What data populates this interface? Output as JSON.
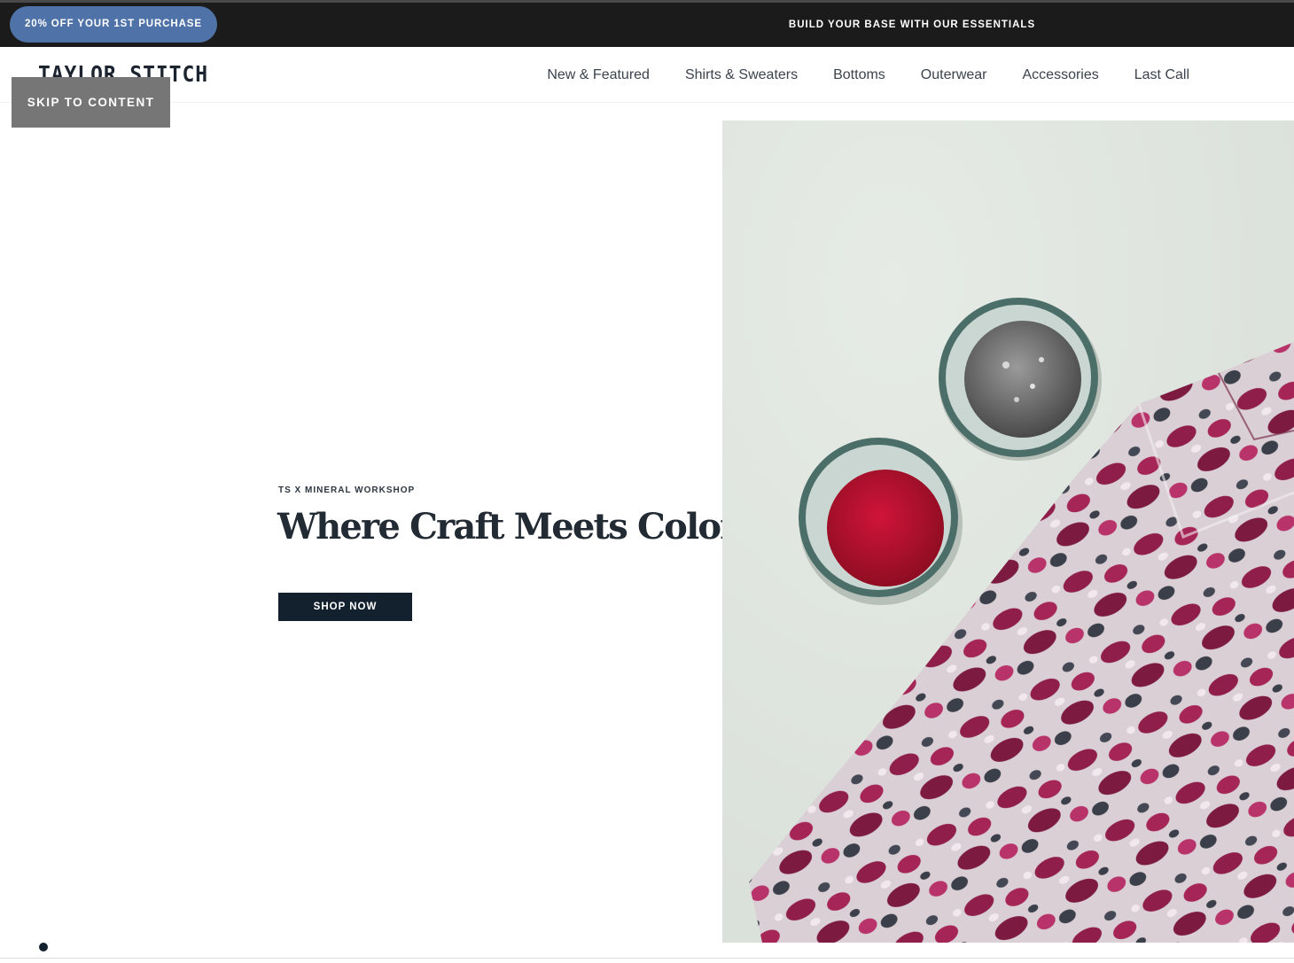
{
  "promo_bar": {
    "pill_label": "20% OFF YOUR 1ST PURCHASE",
    "message": "BUILD YOUR BASE WITH OUR ESSENTIALS"
  },
  "header": {
    "logo": "TAYLOR STITCH",
    "nav": [
      {
        "label": "New & Featured"
      },
      {
        "label": "Shirts & Sweaters"
      },
      {
        "label": "Bottoms"
      },
      {
        "label": "Outerwear"
      },
      {
        "label": "Accessories"
      },
      {
        "label": "Last Call"
      }
    ]
  },
  "skip_link": "SKIP TO CONTENT",
  "hero": {
    "eyebrow": "TS X MINERAL WORKSHOP",
    "title": "Where Craft Meets Color",
    "cta": "SHOP NOW",
    "image_subject": "tie-dyed crimson shirt beside bowls of red and silver mineral pigment",
    "slide_count": 1,
    "active_slide": 1
  },
  "colors": {
    "promo_bar_bg": "#1b1b1b",
    "promo_pill": "#4f73a8",
    "skip_link_bg": "#767676",
    "cta_bg": "#13212e",
    "pigment_red": "#b5102c",
    "fabric_magenta": "#8f1f4a"
  }
}
